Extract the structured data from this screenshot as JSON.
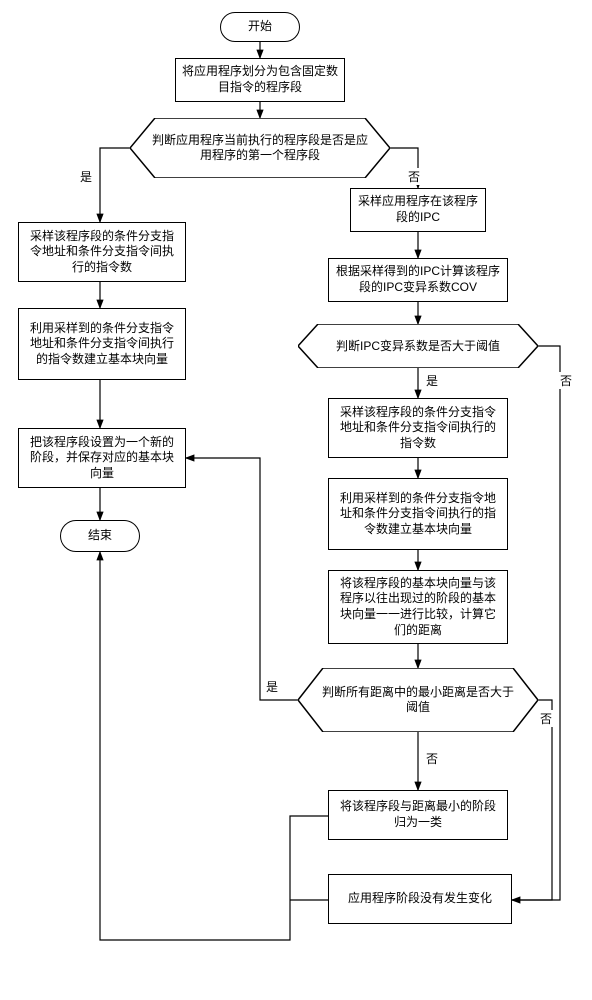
{
  "nodes": {
    "start": "开始",
    "end": "结束",
    "divide": "将应用程序划分为包含固定数目指令的程序段",
    "d1": "判断应用程序当前执行的程序段是否是应用程序的第一个程序段",
    "p_left1": "采样该程序段的条件分支指令地址和条件分支指令间执行的指令数",
    "p_left2": "利用采样到的条件分支指令地址和条件分支指令间执行的指令数建立基本块向量",
    "p_left3": "把该程序段设置为一个新的阶段，并保存对应的基本块向量",
    "p_right1": "采样应用程序在该程序段的IPC",
    "p_right2": "根据采样得到的IPC计算该程序段的IPC变异系数COV",
    "d2": "判断IPC变异系数是否大于阈值",
    "p_right3": "采样该程序段的条件分支指令地址和条件分支指令间执行的指令数",
    "p_right4": "利用采样到的条件分支指令地址和条件分支指令间执行的指令数建立基本块向量",
    "p_right5": "将该程序段的基本块向量与该程序以往出现过的阶段的基本块向量一一进行比较，计算它们的距离",
    "d3": "判断所有距离中的最小距离是否大于阈值",
    "p_right6": "将该程序段与距离最小的阶段归为一类",
    "p_right7": "应用程序阶段没有发生变化"
  },
  "labels": {
    "yes": "是",
    "no": "否"
  }
}
